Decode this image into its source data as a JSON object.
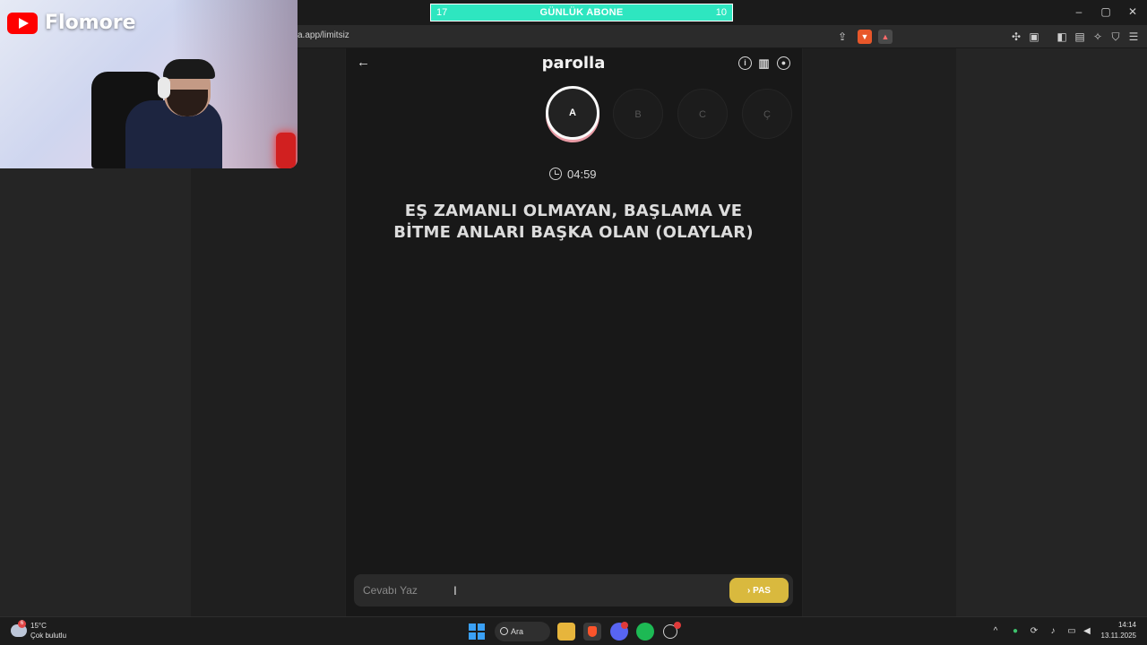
{
  "browser": {
    "url": "a.app/limitsiz",
    "window_controls": {
      "minimize": "–",
      "maximize": "▢",
      "close": "✕"
    }
  },
  "overlay": {
    "channel_name": "Flomore",
    "sub_goal": {
      "current": "17",
      "label": "GÜNLÜK ABONE",
      "target": "10"
    }
  },
  "app": {
    "brand": "parolla",
    "letters": [
      {
        "label": "A",
        "state": "active"
      },
      {
        "label": "B",
        "state": "idle"
      },
      {
        "label": "C",
        "state": "idle"
      },
      {
        "label": "Ç",
        "state": "idle"
      }
    ],
    "timer": "04:59",
    "question_line1": "EŞ ZAMANLI OLMAYAN, BAŞLAMA VE",
    "question_line2": "BİTME ANLARI BAŞKA OLAN (OLAYLAR)",
    "answer_placeholder": "Cevabı Yaz",
    "pass_label": "PAS",
    "colors": {
      "accent": "#d9b93e",
      "active_ring": "#e89aa4",
      "panel": "#181818"
    }
  },
  "taskbar": {
    "weather_temp": "15°C",
    "weather_desc": "Çok bulutlu",
    "weather_badge": "6",
    "search_label": "Ara",
    "time": "14:14",
    "date": "13.11.2025"
  }
}
